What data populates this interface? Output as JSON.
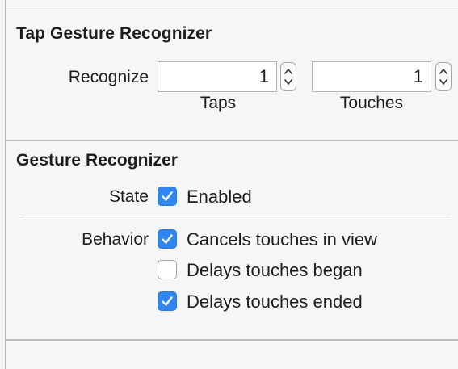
{
  "tap_section": {
    "title": "Tap Gesture Recognizer",
    "recognize_label": "Recognize",
    "taps": {
      "value": "1",
      "label": "Taps"
    },
    "touches": {
      "value": "1",
      "label": "Touches"
    }
  },
  "gesture_section": {
    "title": "Gesture Recognizer",
    "state_label": "State",
    "state_enabled": {
      "label": "Enabled",
      "checked": true
    },
    "behavior_label": "Behavior",
    "behaviors": [
      {
        "label": "Cancels touches in view",
        "checked": true
      },
      {
        "label": "Delays touches began",
        "checked": false
      },
      {
        "label": "Delays touches ended",
        "checked": true
      }
    ]
  },
  "colors": {
    "accent": "#2f86f0",
    "background": "#f6f6f6"
  }
}
